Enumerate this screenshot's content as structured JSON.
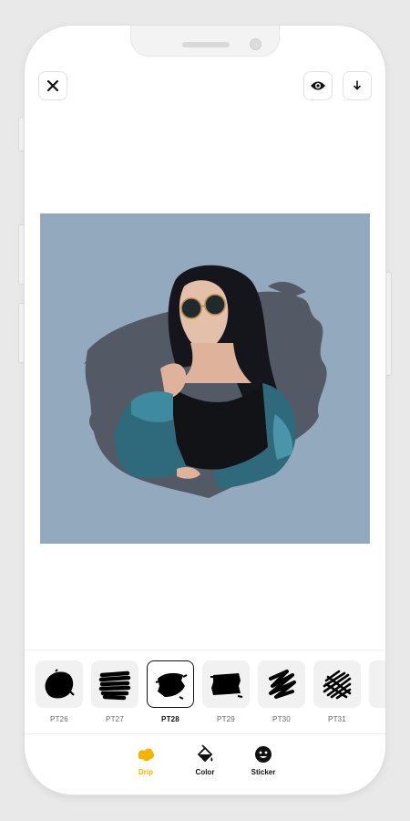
{
  "brushes": [
    {
      "label": "PT26"
    },
    {
      "label": "PT27"
    },
    {
      "label": "PT28"
    },
    {
      "label": "PT29"
    },
    {
      "label": "PT30"
    },
    {
      "label": "PT31"
    }
  ],
  "tabs": [
    {
      "label": "Drip"
    },
    {
      "label": "Color"
    },
    {
      "label": "Sticker"
    }
  ],
  "colors": {
    "canvas_background": "#93a9bd",
    "brush_shape": "#535a66",
    "active_tab": "#f2b400"
  }
}
